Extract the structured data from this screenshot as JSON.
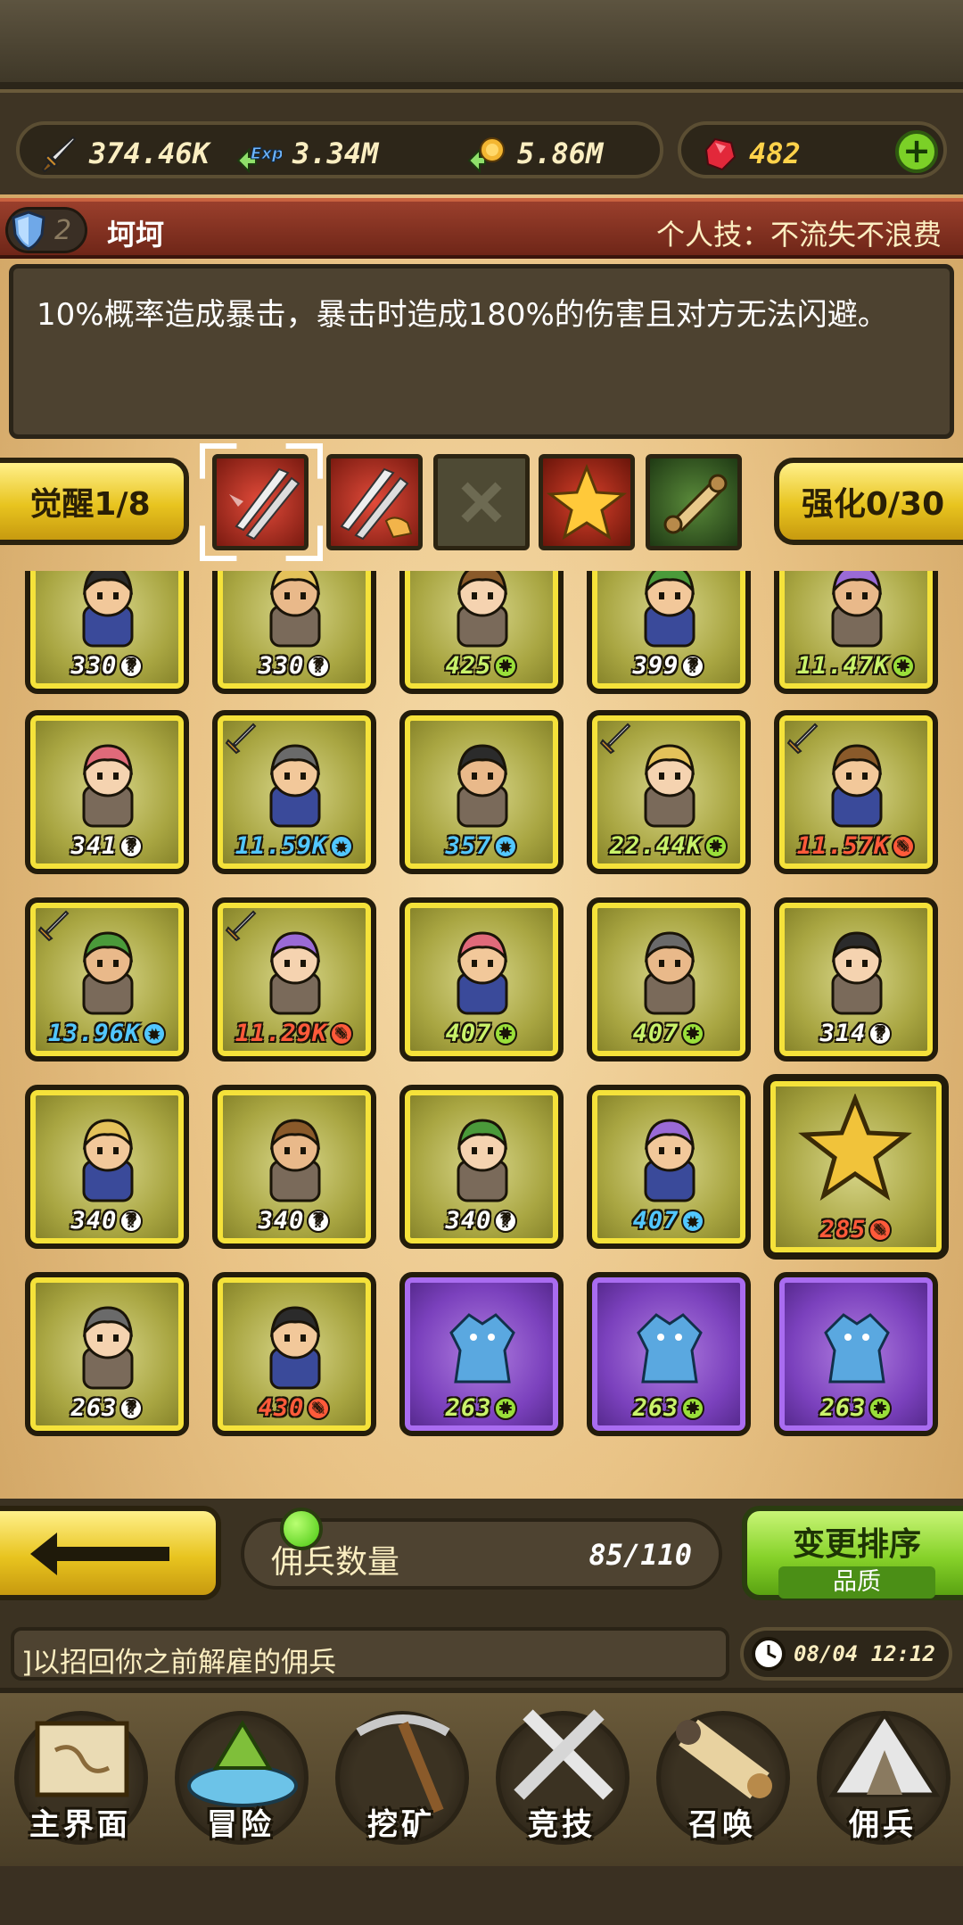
{
  "resources": {
    "power": "374.46K",
    "exp": "3.34M",
    "gold": "5.86M",
    "gems": "482"
  },
  "skill": {
    "hero_level_badge": "2",
    "hero_name": "坷坷",
    "title": "个人技：不流失不浪费",
    "description": "10%概率造成暴击，暴击时造成180%的伤害且对方无法闪避。"
  },
  "awaken": {
    "awaken_label": "觉醒1/8",
    "enhance_label": "强化0/30",
    "slots": [
      "double-sword-skill-icon",
      "double-sword-handshake-skill-icon",
      "empty-slot-icon",
      "star-skill-icon",
      "scroll-skill-icon"
    ]
  },
  "heroes": [
    {
      "level": "330",
      "badge": "?",
      "type": "unknown",
      "frame": "gold",
      "sword": false,
      "color": "#fff"
    },
    {
      "level": "330",
      "badge": "?",
      "type": "unknown",
      "frame": "gold",
      "sword": false,
      "color": "#fff"
    },
    {
      "level": "425",
      "badge": "+",
      "type": "plus",
      "frame": "gold",
      "sword": false,
      "color": "#c9f26a"
    },
    {
      "level": "399",
      "badge": "?",
      "type": "unknown",
      "frame": "gold",
      "sword": false,
      "color": "#fff"
    },
    {
      "level": "11.47K",
      "badge": "+",
      "type": "plus",
      "frame": "gold",
      "sword": false,
      "color": "#c9f26a"
    },
    {
      "level": "341",
      "badge": "?",
      "type": "unknown",
      "frame": "gold",
      "sword": false,
      "color": "#fff"
    },
    {
      "level": "11.59K",
      "badge": "★",
      "type": "star",
      "frame": "gold",
      "sword": true,
      "color": "#52c7ff"
    },
    {
      "level": "357",
      "badge": "★",
      "type": "star",
      "frame": "gold",
      "sword": false,
      "color": "#52c7ff"
    },
    {
      "level": "22.44K",
      "badge": "+",
      "type": "plus",
      "frame": "gold",
      "sword": true,
      "color": "#c9f26a"
    },
    {
      "level": "11.57K",
      "badge": "✎",
      "type": "pen",
      "frame": "gold",
      "sword": true,
      "color": "#ff5a3a"
    },
    {
      "level": "13.96K",
      "badge": "★",
      "type": "star",
      "frame": "gold",
      "sword": true,
      "color": "#52c7ff"
    },
    {
      "level": "11.29K",
      "badge": "✎",
      "type": "pen",
      "frame": "gold",
      "sword": true,
      "color": "#ff5a3a"
    },
    {
      "level": "407",
      "badge": "+",
      "type": "plus",
      "frame": "gold",
      "sword": false,
      "color": "#c9f26a"
    },
    {
      "level": "407",
      "badge": "+",
      "type": "plus",
      "frame": "gold",
      "sword": false,
      "color": "#c9f26a"
    },
    {
      "level": "314",
      "badge": "?",
      "type": "unknown",
      "frame": "gold",
      "sword": false,
      "color": "#fff"
    },
    {
      "level": "340",
      "badge": "?",
      "type": "unknown",
      "frame": "gold",
      "sword": false,
      "color": "#fff"
    },
    {
      "level": "340",
      "badge": "?",
      "type": "unknown",
      "frame": "gold",
      "sword": false,
      "color": "#fff"
    },
    {
      "level": "340",
      "badge": "?",
      "type": "unknown",
      "frame": "gold",
      "sword": false,
      "color": "#fff"
    },
    {
      "level": "407",
      "badge": "★",
      "type": "star",
      "frame": "gold",
      "sword": false,
      "color": "#52c7ff"
    },
    {
      "level": "285",
      "badge": "✎",
      "type": "pen",
      "frame": "gold",
      "sword": false,
      "color": "#ff5a3a",
      "selected": true
    },
    {
      "level": "263",
      "badge": "?",
      "type": "unknown",
      "frame": "gold",
      "sword": false,
      "color": "#fff"
    },
    {
      "level": "430",
      "badge": "✎",
      "type": "pen",
      "frame": "gold",
      "sword": false,
      "color": "#ff5a3a"
    },
    {
      "level": "263",
      "badge": "+",
      "type": "plus",
      "frame": "purple",
      "sword": false,
      "color": "#c9f26a"
    },
    {
      "level": "263",
      "badge": "+",
      "type": "plus",
      "frame": "purple",
      "sword": false,
      "color": "#c9f26a"
    },
    {
      "level": "263",
      "badge": "+",
      "type": "plus",
      "frame": "purple",
      "sword": false,
      "color": "#c9f26a"
    }
  ],
  "roster": {
    "count_label": "佣兵数量",
    "count_value": "85/110",
    "sort_label": "变更排序",
    "sort_mode": "品质"
  },
  "tip": "]以招回你之前解雇的佣兵",
  "clock": "08/04 12:12",
  "nav": [
    {
      "label": "主界面",
      "icon": "map-scroll-icon"
    },
    {
      "label": "冒险",
      "icon": "island-icon"
    },
    {
      "label": "挖矿",
      "icon": "pickaxe-icon"
    },
    {
      "label": "竞技",
      "icon": "crossed-swords-icon"
    },
    {
      "label": "召唤",
      "icon": "summon-scroll-icon"
    },
    {
      "label": "佣兵",
      "icon": "tent-icon"
    }
  ],
  "colors": {
    "gold_button": "#e8c41f",
    "green_button": "#87d22a",
    "skill_bar": "#9a3f2c",
    "panel": "#4d4230"
  }
}
